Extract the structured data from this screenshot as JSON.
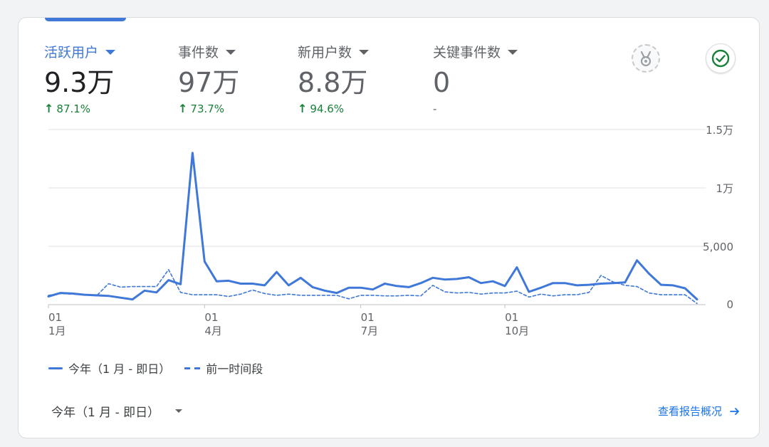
{
  "metrics": [
    {
      "label": "活跃用户",
      "value": "9.3万",
      "change": "87.1%",
      "active": true
    },
    {
      "label": "事件数",
      "value": "97万",
      "change": "73.7%",
      "active": false
    },
    {
      "label": "新用户数",
      "value": "8.8万",
      "change": "94.6%",
      "active": false
    },
    {
      "label": "关键事件数",
      "value": "0",
      "change": "-",
      "active": false
    }
  ],
  "icons": {
    "insights": "insights-badge-icon",
    "status": "check-circle-icon"
  },
  "colors": {
    "accent": "#3f78d8",
    "positive": "#188038"
  },
  "legend": {
    "current": "今年（1 月 - 即日）",
    "previous": "前一时间段"
  },
  "footer": {
    "date_range": "今年（1 月 - 即日）",
    "report_link": "查看报告概况"
  },
  "chart_data": {
    "type": "line",
    "y_tick_labels": [
      "0",
      "5,000",
      "1万",
      "1.5万"
    ],
    "ylim": [
      0,
      15000
    ],
    "x_tick_labels": [
      {
        "day": "01",
        "month": "1月"
      },
      {
        "day": "01",
        "month": "4月"
      },
      {
        "day": "01",
        "month": "7月"
      },
      {
        "day": "01",
        "month": "10月"
      }
    ],
    "x_tick_indices": [
      0,
      13,
      26,
      38
    ],
    "series": [
      {
        "name": "今年（1 月 - 即日）",
        "style": "solid",
        "values": [
          700,
          1000,
          950,
          850,
          800,
          750,
          600,
          450,
          1200,
          1050,
          2100,
          1750,
          13000,
          3700,
          2000,
          2050,
          1800,
          1800,
          1650,
          2800,
          1650,
          2300,
          1500,
          1200,
          1000,
          1450,
          1450,
          1300,
          1800,
          1600,
          1500,
          1850,
          2300,
          2150,
          2200,
          2350,
          1850,
          2000,
          1600,
          3200,
          1100,
          1450,
          1850,
          1850,
          1650,
          1700,
          1800,
          1850,
          1900,
          3800,
          2650,
          1700,
          1650,
          1400,
          450
        ]
      },
      {
        "name": "前一时间段",
        "style": "dashed",
        "values": [
          800,
          950,
          900,
          850,
          750,
          1800,
          1500,
          1550,
          1550,
          1550,
          3000,
          1050,
          850,
          850,
          850,
          700,
          900,
          1250,
          950,
          800,
          900,
          800,
          800,
          800,
          800,
          500,
          800,
          800,
          750,
          750,
          800,
          750,
          1650,
          1100,
          1000,
          1050,
          900,
          1000,
          1000,
          1150,
          650,
          900,
          750,
          850,
          850,
          1050,
          2500,
          1950,
          1650,
          1550,
          1000,
          850,
          850,
          850,
          100
        ]
      }
    ]
  }
}
